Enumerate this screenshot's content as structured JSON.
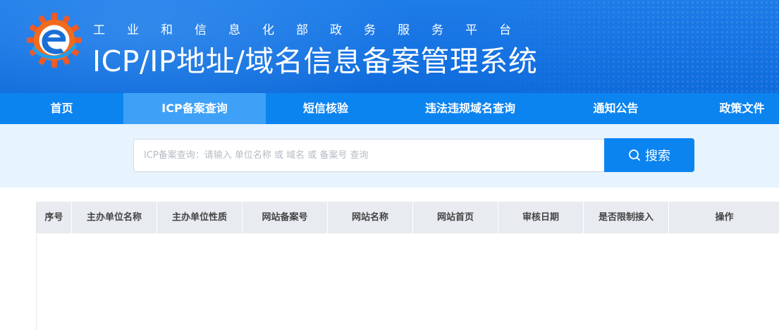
{
  "header": {
    "subtitle": "工业和信息化部政务服务平台",
    "title": "ICP/IP地址/域名信息备案管理系统"
  },
  "nav": {
    "items": [
      "首页",
      "ICP备案查询",
      "短信核验",
      "违法违规域名查询",
      "通知公告",
      "政策文件"
    ],
    "active": "ICP备案查询"
  },
  "search": {
    "placeholder": "ICP备案查询：请输入 单位名称 或 域名 或 备案号 查询",
    "value": "",
    "button_label": "搜索"
  },
  "table": {
    "columns": [
      "序号",
      "主办单位名称",
      "主办单位性质",
      "网站备案号",
      "网站名称",
      "网站首页",
      "审核日期",
      "是否限制接入",
      "操作"
    ],
    "rows": []
  },
  "colors": {
    "banner": "#1673e2",
    "nav": "#0c84f0",
    "nav_active": "#3ea1f7",
    "search_band": "#e7f3fd",
    "table_header": "#e8ecf1"
  },
  "icons": [
    "logo-gear-e-icon",
    "search-icon"
  ]
}
